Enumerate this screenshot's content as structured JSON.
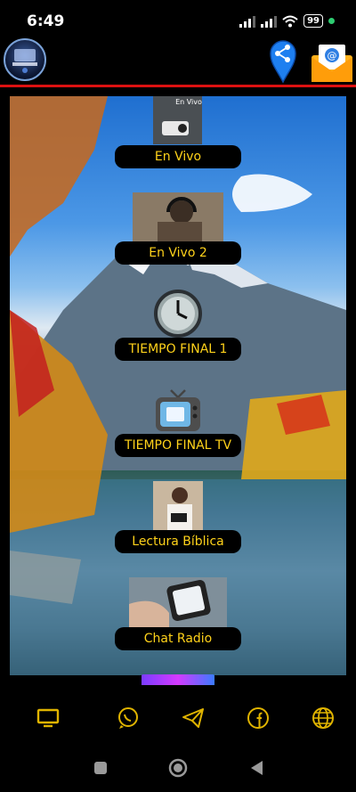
{
  "status_bar": {
    "time": "6:49",
    "battery": "99"
  },
  "header": {
    "logo_icon": "station-logo-icon",
    "share_icon": "share-location-icon",
    "mail_icon": "email-icon",
    "accent_color": "#d11111"
  },
  "menu": {
    "items": [
      {
        "label": "En Vivo",
        "icon": "live-radio-thumbnail",
        "badge": "En Vivo"
      },
      {
        "label": "En Vivo 2",
        "icon": "headphones-listener-thumbnail"
      },
      {
        "label": "TIEMPO FINAL 1",
        "icon": "clock-thumbnail"
      },
      {
        "label": "TIEMPO FINAL TV",
        "icon": "tv-thumbnail"
      },
      {
        "label": "Lectura Bíblica",
        "icon": "bible-reading-thumbnail"
      },
      {
        "label": "Chat Radio",
        "icon": "phone-chat-thumbnail"
      }
    ],
    "pill_text_color": "#ffd21a"
  },
  "bottom_nav": {
    "items": [
      {
        "icon": "tv-icon"
      },
      {
        "icon": "whatsapp-icon"
      },
      {
        "icon": "telegram-icon"
      },
      {
        "icon": "facebook-icon"
      },
      {
        "icon": "web-globe-icon"
      }
    ],
    "icon_color": "#e0b400"
  },
  "system_nav": {
    "buttons": [
      "recents-button",
      "home-button",
      "back-button"
    ]
  }
}
